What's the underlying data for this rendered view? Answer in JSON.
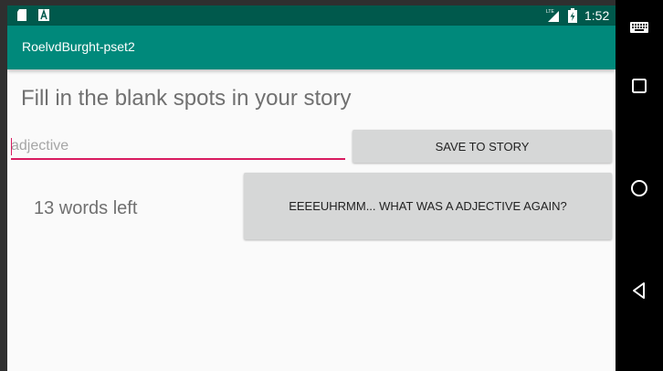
{
  "status_bar": {
    "time": "1:52",
    "network_label": "LTE",
    "icons": [
      "sd-card-icon",
      "a-notification-icon",
      "lte-signal-icon",
      "battery-charging-icon"
    ]
  },
  "app_bar": {
    "title": "RoelvdBurght-pset2",
    "color": "#00897b",
    "status_color": "#00594c"
  },
  "main": {
    "prompt": "Fill in the blank spots in your story",
    "input": {
      "value": "",
      "placeholder": "adjective",
      "underline_color": "#d81b60"
    },
    "save_button": "SAVE TO STORY",
    "words_left": "13 words left",
    "hint_button": "EEEEUHRMM... WHAT WAS A ADJECTIVE AGAIN?"
  },
  "nav_bar": {
    "icons": [
      "keyboard-icon",
      "recents-icon",
      "home-icon",
      "back-icon"
    ]
  }
}
